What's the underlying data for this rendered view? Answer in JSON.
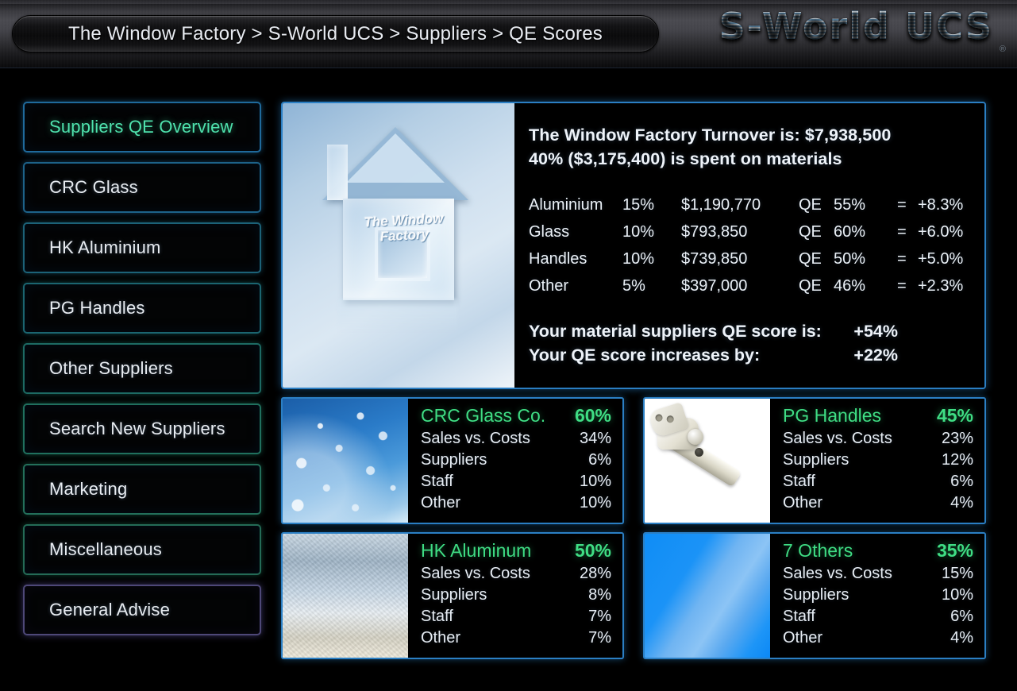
{
  "header": {
    "breadcrumb": "The Window Factory > S-World UCS > Suppliers > QE Scores",
    "logo": "S-World UCS",
    "registered_mark": "®"
  },
  "sidebar": {
    "items": [
      {
        "label": "Suppliers QE Overview",
        "active": true,
        "tone": "t-blue"
      },
      {
        "label": "CRC Glass",
        "active": false,
        "tone": "t-blue2"
      },
      {
        "label": "HK Aluminium",
        "active": false,
        "tone": "t-bluegrn"
      },
      {
        "label": "PG Handles",
        "active": false,
        "tone": "t-teal"
      },
      {
        "label": "Other Suppliers",
        "active": false,
        "tone": "t-teal2"
      },
      {
        "label": "Search New Suppliers",
        "active": false,
        "tone": "t-green"
      },
      {
        "label": "Marketing",
        "active": false,
        "tone": "t-green2"
      },
      {
        "label": "Miscellaneous",
        "active": false,
        "tone": "t-green3"
      },
      {
        "label": "General Advise",
        "active": false,
        "tone": "t-purple"
      }
    ]
  },
  "hero": {
    "image_caption_line1": "The Window",
    "image_caption_line2": "Factory",
    "title_line1": "The Window Factory Turnover is: $7,938,500",
    "title_line2": "40% ($3,175,400) is spent on materials",
    "materials": [
      {
        "name": "Aluminium",
        "pct": "15%",
        "amount": "$1,190,770",
        "qe_label": "QE",
        "qe": "55%",
        "eq": "=",
        "result": "+8.3%"
      },
      {
        "name": "Glass",
        "pct": "10%",
        "amount": "$793,850",
        "qe_label": "QE",
        "qe": "60%",
        "eq": "=",
        "result": "+6.0%"
      },
      {
        "name": "Handles",
        "pct": "10%",
        "amount": "$739,850",
        "qe_label": "QE",
        "qe": "50%",
        "eq": "=",
        "result": "+5.0%"
      },
      {
        "name": "Other",
        "pct": "5%",
        "amount": "$397,000",
        "qe_label": "QE",
        "qe": "46%",
        "eq": "=",
        "result": "+2.3%"
      }
    ],
    "summary": [
      {
        "label": "Your material suppliers QE score is:",
        "value": "+54%"
      },
      {
        "label": "Your QE score increases by:",
        "value": "+22%"
      }
    ]
  },
  "cards": [
    {
      "title": "CRC Glass Co.",
      "score": "60%",
      "image": "water-droplets-on-blue-glass",
      "rows": [
        {
          "k": "Sales vs. Costs",
          "v": "34%"
        },
        {
          "k": "Suppliers",
          "v": "6%"
        },
        {
          "k": "Staff",
          "v": "10%"
        },
        {
          "k": "Other",
          "v": "10%"
        }
      ]
    },
    {
      "title": "PG Handles",
      "score": "45%",
      "image": "window-handle-on-white",
      "rows": [
        {
          "k": "Sales vs. Costs",
          "v": "23%"
        },
        {
          "k": "Suppliers",
          "v": "12%"
        },
        {
          "k": "Staff",
          "v": "6%"
        },
        {
          "k": "Other",
          "v": "4%"
        }
      ]
    },
    {
      "title": "HK Aluminum",
      "score": "50%",
      "image": "frosted-aluminium-texture",
      "rows": [
        {
          "k": "Sales vs. Costs",
          "v": "28%"
        },
        {
          "k": "Suppliers",
          "v": "8%"
        },
        {
          "k": "Staff",
          "v": "7%"
        },
        {
          "k": "Other",
          "v": "7%"
        }
      ]
    },
    {
      "title": "7 Others",
      "score": "35%",
      "image": "blue-gradient-sheet",
      "rows": [
        {
          "k": "Sales vs. Costs",
          "v": "15%"
        },
        {
          "k": "Suppliers",
          "v": "10%"
        },
        {
          "k": "Staff",
          "v": "6%"
        },
        {
          "k": "Other",
          "v": "4%"
        }
      ]
    }
  ],
  "colors": {
    "accent_blue": "#2b7fc4",
    "accent_green": "#3fdd84",
    "active_text": "#4fe2ad",
    "purple_border": "#4e4878",
    "background": "#000000",
    "text": "#eaf0f6"
  }
}
